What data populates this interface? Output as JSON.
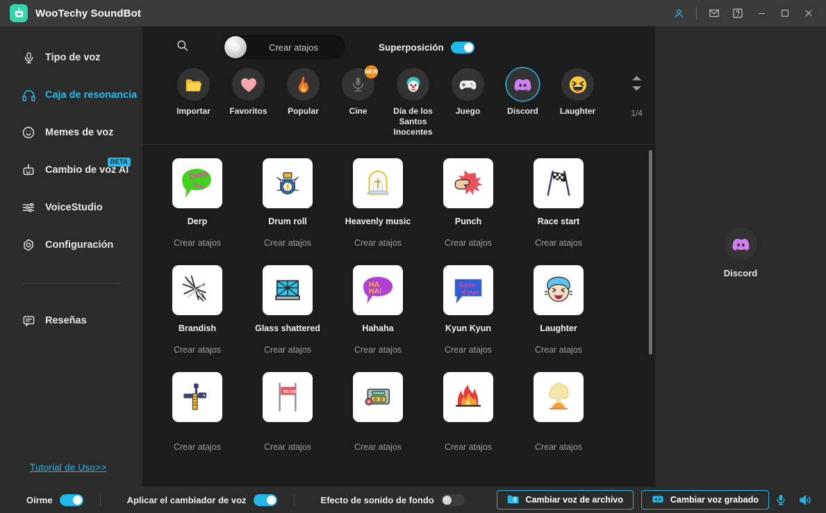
{
  "window": {
    "title": "WooTechy SoundBot",
    "logo_icon": "robot-logo-icon",
    "controls": {
      "account": "account-icon",
      "mail": "mail-icon",
      "help": "help-icon",
      "minimize": "minimize-icon",
      "maximize": "maximize-icon",
      "close": "close-icon"
    },
    "accent_color": "#22b9e8",
    "logo_color": "#35d5ae"
  },
  "sidebar": {
    "items": [
      {
        "label": "Tipo de voz",
        "icon": "microphone-icon",
        "active": false,
        "badge": ""
      },
      {
        "label": "Caja de resonancia",
        "icon": "headphones-icon",
        "active": true,
        "badge": ""
      },
      {
        "label": "Memes de voz",
        "icon": "smiley-icon",
        "active": false,
        "badge": ""
      },
      {
        "label": "Cambio de voz AI",
        "icon": "robot-icon",
        "active": false,
        "badge": "BETA"
      },
      {
        "label": "VoiceStudio",
        "icon": "sliders-icon",
        "active": false,
        "badge": ""
      },
      {
        "label": "Configuración",
        "icon": "gear-icon",
        "active": false,
        "badge": ""
      }
    ],
    "reviews": {
      "label": "Reseñas",
      "icon": "comment-icon"
    },
    "tutorial_link": "Tutorial de Uso>>"
  },
  "toolbar": {
    "search_icon": "search-icon",
    "shortcut_pill_label": "Crear atajos",
    "power_icon": "power-icon",
    "overlay_label": "Superposición",
    "overlay_on": true
  },
  "categories": {
    "items": [
      {
        "label": "Importar",
        "icon": "import-folder-icon",
        "glyph": "📂",
        "selected": false,
        "badge": ""
      },
      {
        "label": "Favoritos",
        "icon": "heart-icon",
        "glyph": "💗",
        "selected": false,
        "badge": ""
      },
      {
        "label": "Popular",
        "icon": "fire-icon",
        "glyph": "🔥",
        "selected": false,
        "badge": ""
      },
      {
        "label": "Cine",
        "icon": "microphone-icon",
        "glyph": "🎙",
        "selected": false,
        "badge": "NEW"
      },
      {
        "label": "Día de los Santos Inocentes",
        "icon": "clown-icon",
        "glyph": "🤡",
        "selected": false,
        "badge": ""
      },
      {
        "label": "Juego",
        "icon": "gamepad-icon",
        "glyph": "🎮",
        "selected": false,
        "badge": ""
      },
      {
        "label": "Discord",
        "icon": "discord-icon",
        "glyph": "🎮",
        "selected": true,
        "badge": ""
      },
      {
        "label": "Laughter",
        "icon": "laughing-face-icon",
        "glyph": "😆",
        "selected": false,
        "badge": ""
      }
    ],
    "page_indicator": "1/4",
    "up_arrow": "chevron-up-icon",
    "down_arrow": "chevron-down-icon"
  },
  "sounds": {
    "shortcut_text": "Crear atajos",
    "download_icon": "download-icon",
    "items": [
      {
        "name": "Derp",
        "icon": "derp-speech-bubble-icon",
        "glyph": "💬"
      },
      {
        "name": "Drum roll",
        "icon": "drum-kit-icon",
        "glyph": "🥁"
      },
      {
        "name": "Heavenly music",
        "icon": "heaven-gate-icon",
        "glyph": "⛩"
      },
      {
        "name": "Punch",
        "icon": "punch-fist-icon",
        "glyph": "👊"
      },
      {
        "name": "Race start",
        "icon": "checkered-flags-icon",
        "glyph": "🏁"
      },
      {
        "name": "Brandish",
        "icon": "sword-slash-icon",
        "glyph": "⚔"
      },
      {
        "name": "Glass shattered",
        "icon": "broken-glass-icon",
        "glyph": "🪟"
      },
      {
        "name": "Hahaha",
        "icon": "haha-speech-bubble-icon",
        "glyph": "💬"
      },
      {
        "name": "Kyun Kyun",
        "icon": "kyun-speech-bubble-icon",
        "glyph": "💬"
      },
      {
        "name": "Laughter",
        "icon": "laughing-girl-icon",
        "glyph": "😂"
      },
      {
        "name": "",
        "icon": "machine-gun-icon",
        "glyph": "🔫"
      },
      {
        "name": "",
        "icon": "ready-flag-icon",
        "glyph": "🚩"
      },
      {
        "name": "",
        "icon": "tape-recorder-icon",
        "glyph": "📼"
      },
      {
        "name": "",
        "icon": "explosion-icon",
        "glyph": "💥"
      },
      {
        "name": "",
        "icon": "nuclear-explosion-icon",
        "glyph": "☁"
      }
    ]
  },
  "selected_sound": {
    "label": "Discord",
    "icon": "discord-icon"
  },
  "bottombar": {
    "toggles": [
      {
        "label": "Oírme",
        "on": true
      },
      {
        "label": "Aplicar el cambiador de voz",
        "on": true
      },
      {
        "label": "Efecto de sonido de fondo",
        "on": false
      }
    ],
    "buttons": [
      {
        "label": "Cambiar voz de archivo",
        "icon": "file-voice-icon"
      },
      {
        "label": "Cambiar voz grabado",
        "icon": "record-voice-icon"
      }
    ],
    "icon_buttons": [
      {
        "icon": "microphone-icon"
      },
      {
        "icon": "speaker-icon"
      }
    ]
  }
}
